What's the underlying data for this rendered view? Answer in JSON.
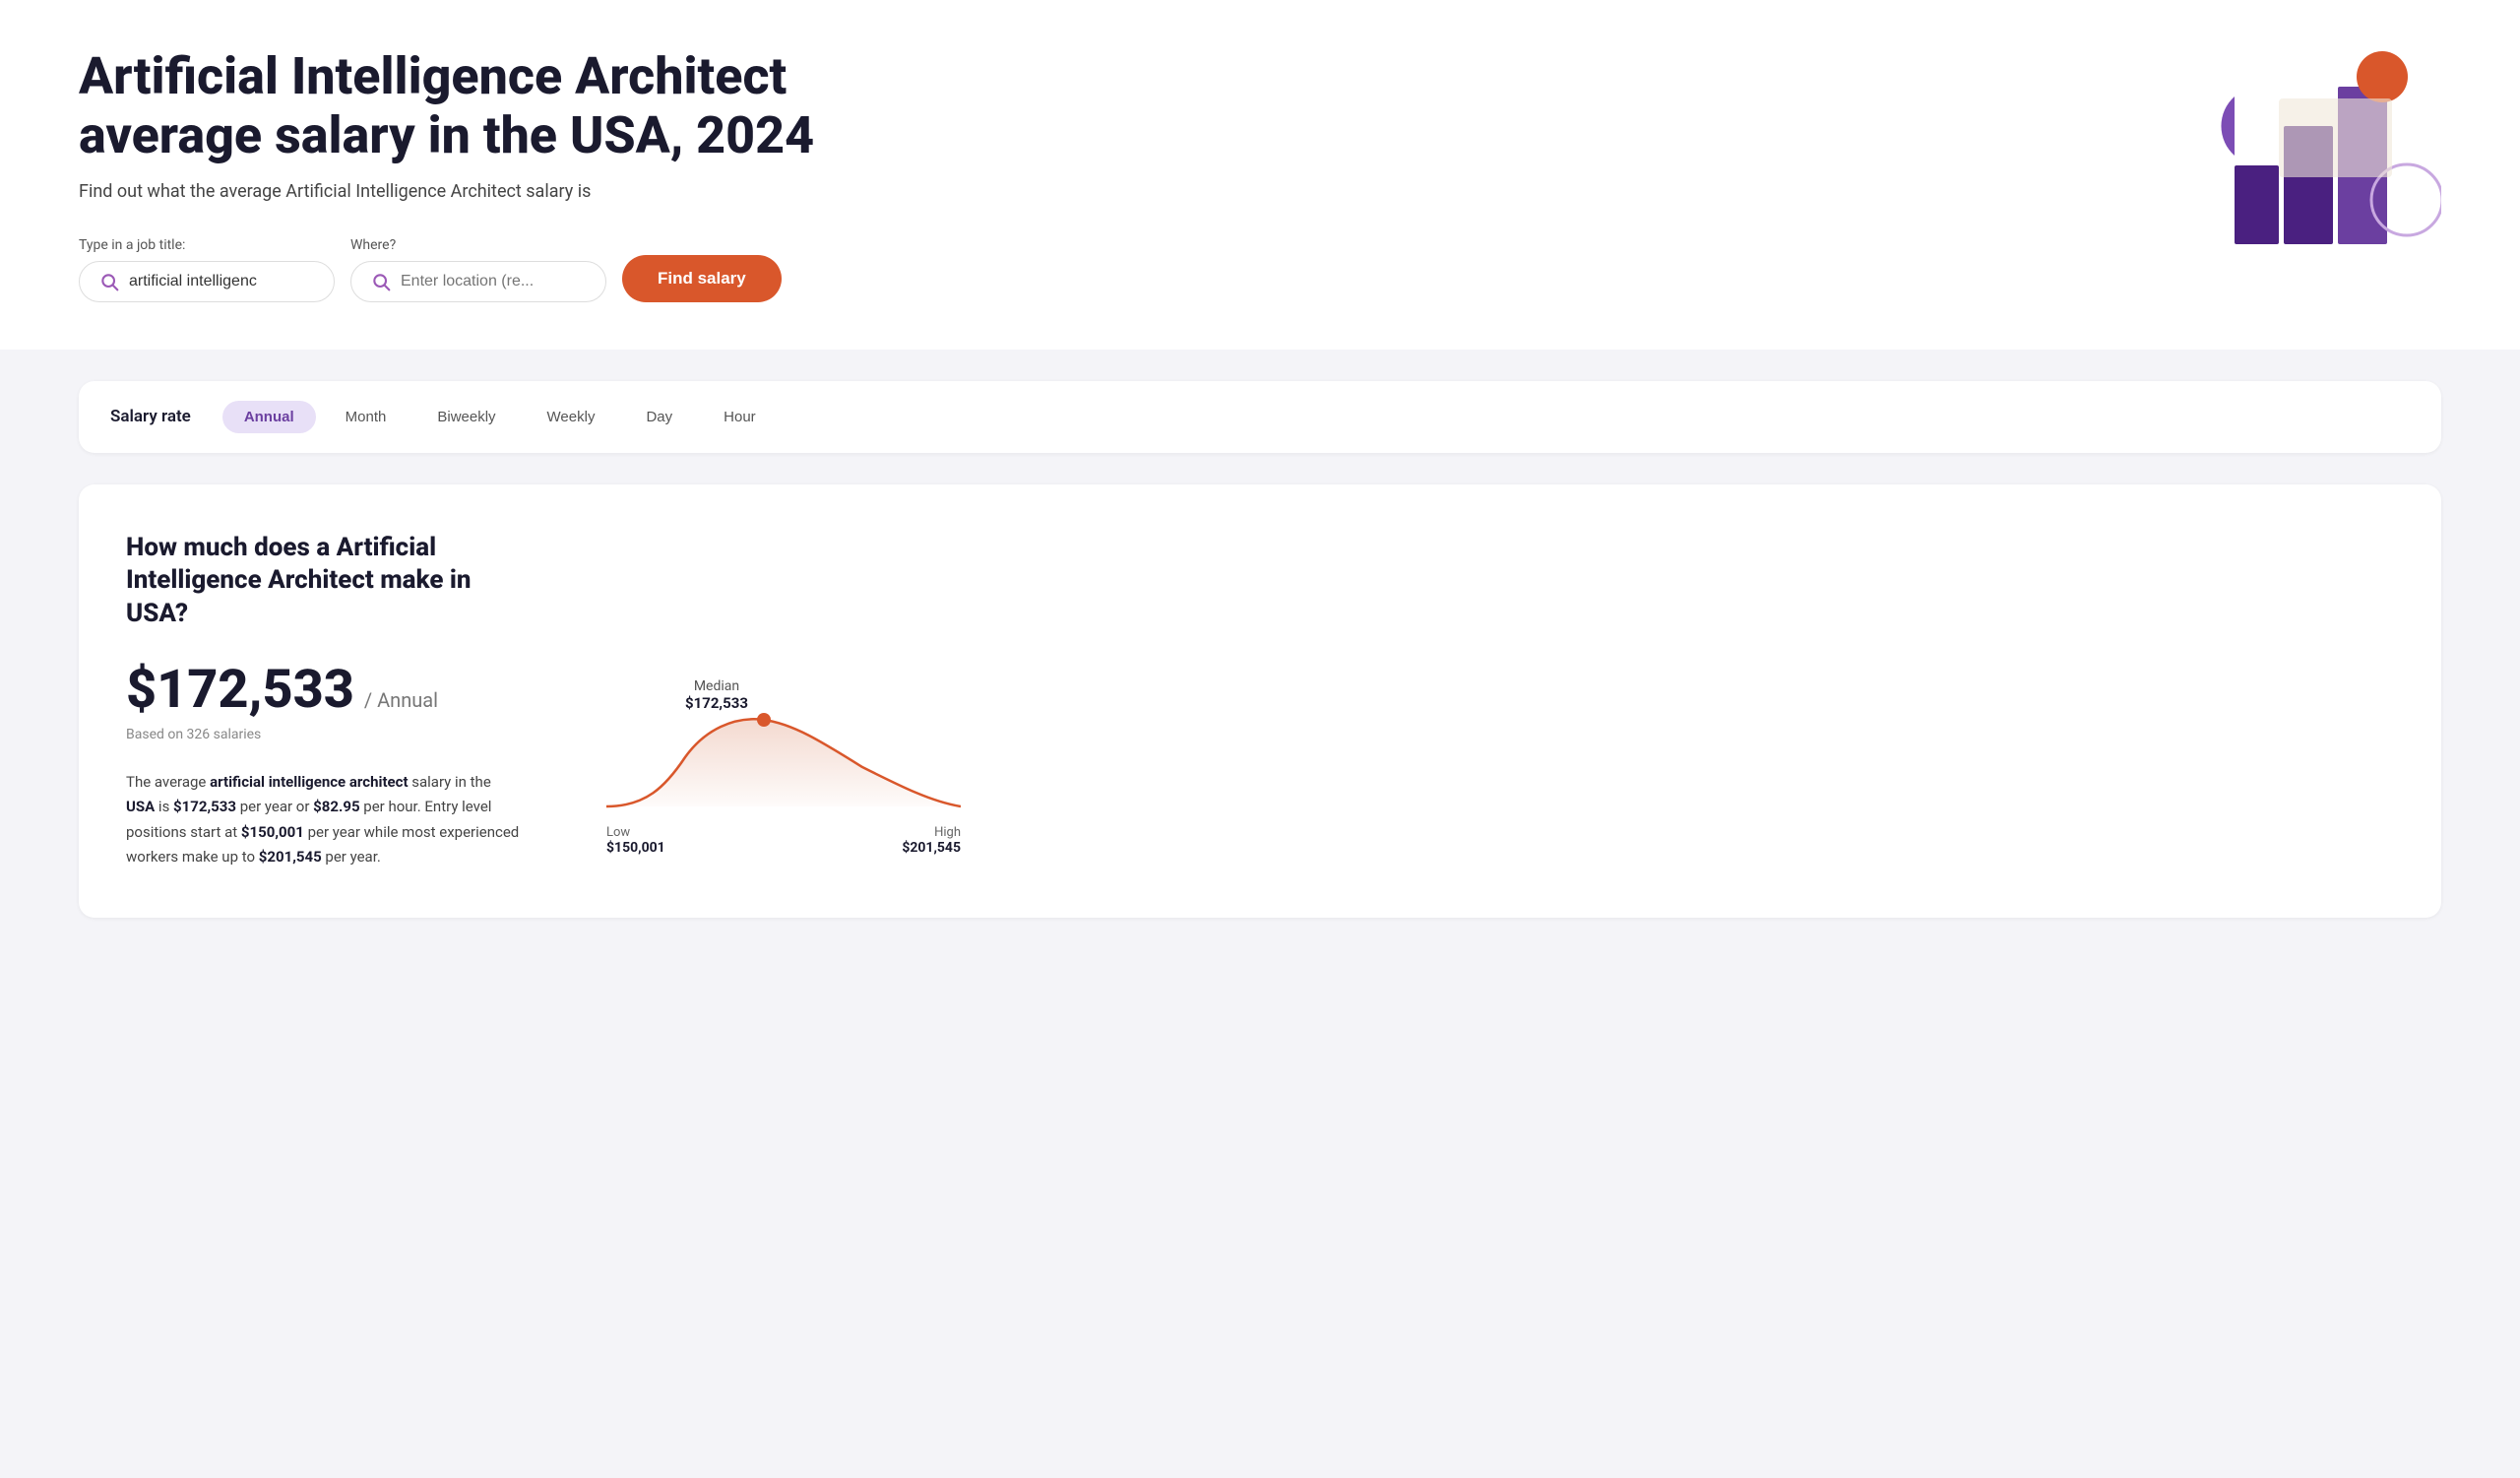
{
  "hero": {
    "title": "Artificial Intelligence Architect average salary in the USA, 2024",
    "subtitle": "Find out what the average Artificial Intelligence Architect salary is",
    "search_job_label": "Type in a job title:",
    "search_job_placeholder": "artificial intelligenc",
    "search_location_label": "Where?",
    "search_location_placeholder": "Enter location (re...",
    "find_button_label": "Find salary"
  },
  "salary_rate": {
    "label": "Salary rate",
    "tabs": [
      {
        "id": "annual",
        "label": "Annual",
        "active": true
      },
      {
        "id": "month",
        "label": "Month",
        "active": false
      },
      {
        "id": "biweekly",
        "label": "Biweekly",
        "active": false
      },
      {
        "id": "weekly",
        "label": "Weekly",
        "active": false
      },
      {
        "id": "day",
        "label": "Day",
        "active": false
      },
      {
        "id": "hour",
        "label": "Hour",
        "active": false
      }
    ]
  },
  "main_card": {
    "title": "How much does a Artificial Intelligence Architect make in USA?",
    "salary_amount": "$172,533",
    "salary_period": "/ Annual",
    "salary_based": "Based on 326 salaries",
    "description_parts": [
      {
        "text": "The average "
      },
      {
        "text": "artificial intelligence architect",
        "bold": true
      },
      {
        "text": " salary in the "
      },
      {
        "text": "USA",
        "bold": true
      },
      {
        "text": " is "
      },
      {
        "text": "$172,533",
        "bold": true
      },
      {
        "text": " per year or "
      },
      {
        "text": "$82.95",
        "bold": true
      },
      {
        "text": " per hour. Entry level positions start at "
      },
      {
        "text": "$150,001",
        "bold": true
      },
      {
        "text": " per year while most experienced workers make up to "
      },
      {
        "text": "$201,545",
        "bold": true
      },
      {
        "text": " per year."
      }
    ],
    "chart": {
      "median_label": "Median",
      "median_value": "$172,533",
      "low_label": "Low",
      "low_value": "$150,001",
      "high_label": "High",
      "high_value": "$201,545"
    }
  }
}
